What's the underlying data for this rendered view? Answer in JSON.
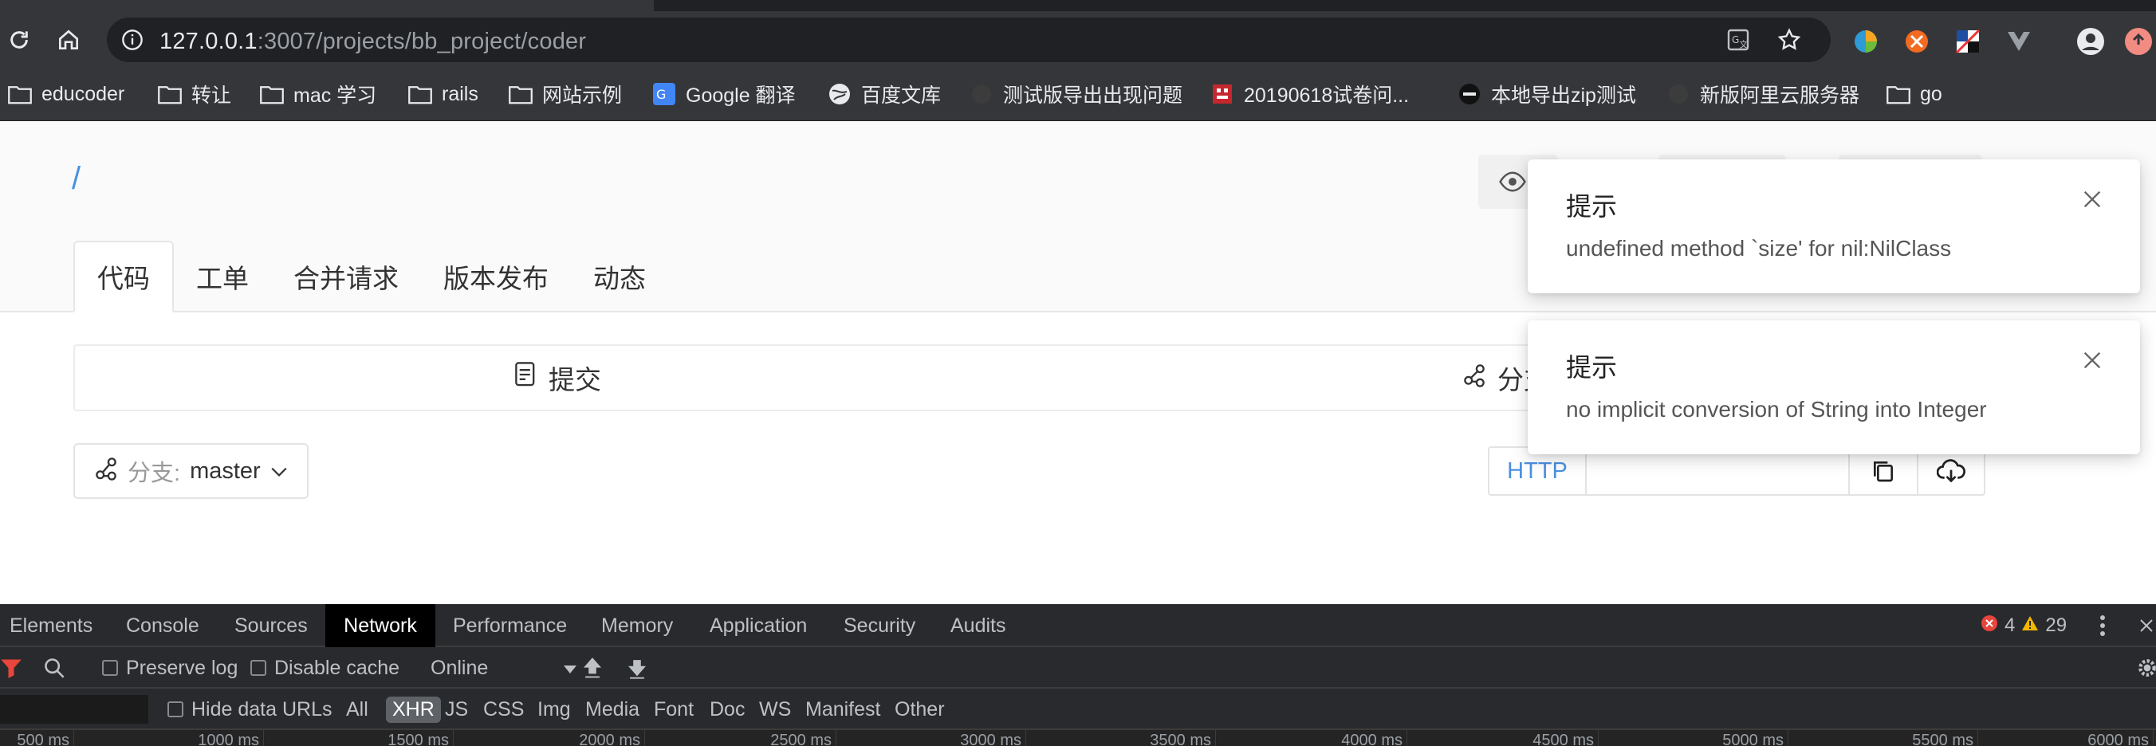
{
  "browser": {
    "url_host": "127.0.0.1",
    "url_rest": ":3007/projects/bb_project/coder",
    "bookmarks": [
      {
        "label": "educoder",
        "icon": "folder-icon"
      },
      {
        "label": "转让",
        "icon": "folder-icon"
      },
      {
        "label": "mac 学习",
        "icon": "folder-icon"
      },
      {
        "label": "rails",
        "icon": "folder-icon"
      },
      {
        "label": "网站示例",
        "icon": "folder-icon"
      },
      {
        "label": "Google 翻译",
        "icon": "google-translate-icon"
      },
      {
        "label": "百度文库",
        "icon": "globe-icon"
      },
      {
        "label": "测试版导出出现问题",
        "icon": "page-icon"
      },
      {
        "label": "20190618试卷问...",
        "icon": "red-favicon"
      },
      {
        "label": "本地导出zip测试",
        "icon": "dark-favicon"
      },
      {
        "label": "新版阿里云服务器",
        "icon": "page-icon"
      },
      {
        "label": "go",
        "icon": "folder-icon"
      }
    ]
  },
  "project": {
    "breadcrumb": "/",
    "tabs": [
      "代码",
      "工单",
      "合并请求",
      "版本发布",
      "动态"
    ],
    "stats": {
      "commits": "提交",
      "branches": "分支"
    },
    "branch_label": "分支:",
    "branch_value": "master",
    "clone_protocol": "HTTP"
  },
  "notifications": [
    {
      "title": "提示",
      "message": "undefined method `size' for nil:NilClass"
    },
    {
      "title": "提示",
      "message": "no implicit conversion of String into Integer"
    }
  ],
  "devtools": {
    "tabs": [
      "Elements",
      "Console",
      "Sources",
      "Network",
      "Performance",
      "Memory",
      "Application",
      "Security",
      "Audits"
    ],
    "active_tab": "Network",
    "errors": "4",
    "warnings": "29",
    "preserve_log": "Preserve log",
    "disable_cache": "Disable cache",
    "throttle": "Online",
    "hide_data_urls": "Hide data URLs",
    "filters": [
      "All",
      "XHR",
      "JS",
      "CSS",
      "Img",
      "Media",
      "Font",
      "Doc",
      "WS",
      "Manifest",
      "Other"
    ],
    "active_filter": "XHR",
    "timeline_ticks": [
      "500 ms",
      "1000 ms",
      "1500 ms",
      "2000 ms",
      "2500 ms",
      "3000 ms",
      "3500 ms",
      "4000 ms",
      "4500 ms",
      "5000 ms",
      "5500 ms",
      "6000 ms"
    ]
  },
  "colors": {
    "accent": "#4a90e2",
    "error": "#e8453c",
    "warning": "#f2b600"
  }
}
